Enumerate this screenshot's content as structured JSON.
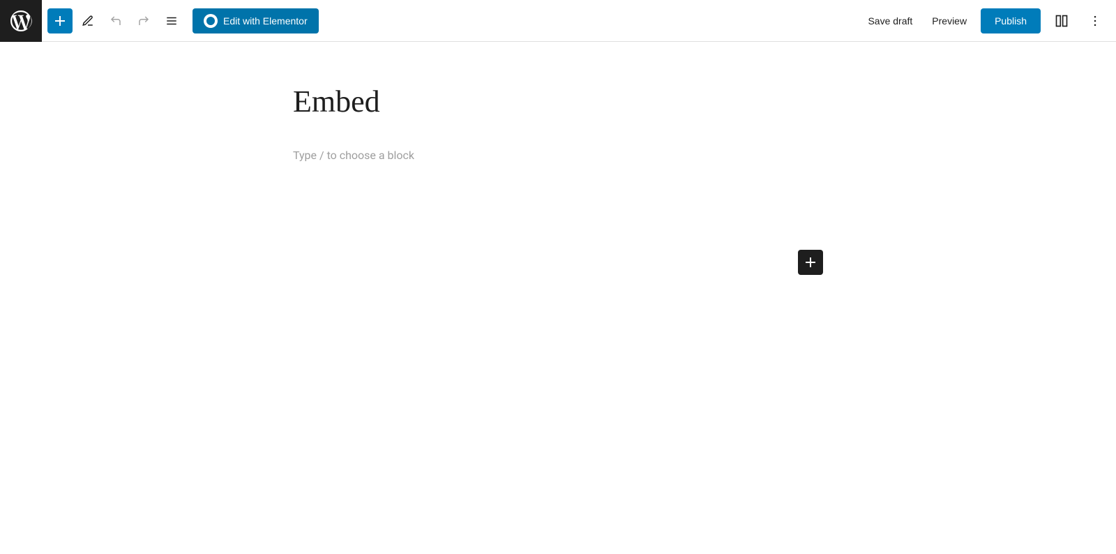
{
  "toolbar": {
    "add_block_label": "+",
    "edit_tools_label": "✎",
    "undo_label": "↩",
    "redo_label": "↪",
    "list_view_label": "≡",
    "edit_elementor_label": "Edit with Elementor",
    "save_draft_label": "Save draft",
    "preview_label": "Preview",
    "publish_label": "Publish",
    "view_toggle_label": "⊡",
    "more_options_label": "⋮"
  },
  "editor": {
    "page_title": "Embed",
    "placeholder": "Type / to choose a block"
  },
  "colors": {
    "primary": "#007cba",
    "dark": "#1e1e1e",
    "elementor_blue": "#0073aa"
  }
}
